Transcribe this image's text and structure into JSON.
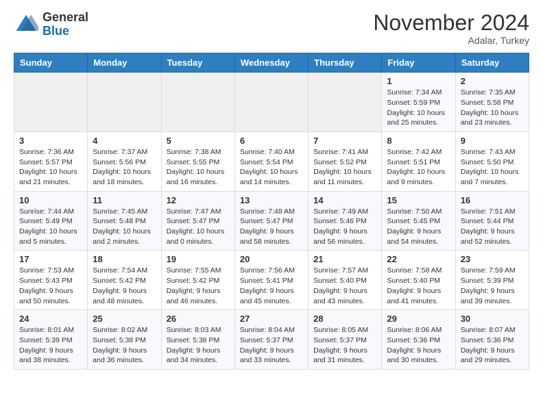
{
  "logo": {
    "general": "General",
    "blue": "Blue"
  },
  "header": {
    "month": "November 2024",
    "location": "Adalar, Turkey"
  },
  "weekdays": [
    "Sunday",
    "Monday",
    "Tuesday",
    "Wednesday",
    "Thursday",
    "Friday",
    "Saturday"
  ],
  "weeks": [
    [
      {
        "day": "",
        "info": ""
      },
      {
        "day": "",
        "info": ""
      },
      {
        "day": "",
        "info": ""
      },
      {
        "day": "",
        "info": ""
      },
      {
        "day": "",
        "info": ""
      },
      {
        "day": "1",
        "info": "Sunrise: 7:34 AM\nSunset: 5:59 PM\nDaylight: 10 hours and 25 minutes."
      },
      {
        "day": "2",
        "info": "Sunrise: 7:35 AM\nSunset: 5:58 PM\nDaylight: 10 hours and 23 minutes."
      }
    ],
    [
      {
        "day": "3",
        "info": "Sunrise: 7:36 AM\nSunset: 5:57 PM\nDaylight: 10 hours and 21 minutes."
      },
      {
        "day": "4",
        "info": "Sunrise: 7:37 AM\nSunset: 5:56 PM\nDaylight: 10 hours and 18 minutes."
      },
      {
        "day": "5",
        "info": "Sunrise: 7:38 AM\nSunset: 5:55 PM\nDaylight: 10 hours and 16 minutes."
      },
      {
        "day": "6",
        "info": "Sunrise: 7:40 AM\nSunset: 5:54 PM\nDaylight: 10 hours and 14 minutes."
      },
      {
        "day": "7",
        "info": "Sunrise: 7:41 AM\nSunset: 5:52 PM\nDaylight: 10 hours and 11 minutes."
      },
      {
        "day": "8",
        "info": "Sunrise: 7:42 AM\nSunset: 5:51 PM\nDaylight: 10 hours and 9 minutes."
      },
      {
        "day": "9",
        "info": "Sunrise: 7:43 AM\nSunset: 5:50 PM\nDaylight: 10 hours and 7 minutes."
      }
    ],
    [
      {
        "day": "10",
        "info": "Sunrise: 7:44 AM\nSunset: 5:49 PM\nDaylight: 10 hours and 5 minutes."
      },
      {
        "day": "11",
        "info": "Sunrise: 7:45 AM\nSunset: 5:48 PM\nDaylight: 10 hours and 2 minutes."
      },
      {
        "day": "12",
        "info": "Sunrise: 7:47 AM\nSunset: 5:47 PM\nDaylight: 10 hours and 0 minutes."
      },
      {
        "day": "13",
        "info": "Sunrise: 7:48 AM\nSunset: 5:47 PM\nDaylight: 9 hours and 58 minutes."
      },
      {
        "day": "14",
        "info": "Sunrise: 7:49 AM\nSunset: 5:46 PM\nDaylight: 9 hours and 56 minutes."
      },
      {
        "day": "15",
        "info": "Sunrise: 7:50 AM\nSunset: 5:45 PM\nDaylight: 9 hours and 54 minutes."
      },
      {
        "day": "16",
        "info": "Sunrise: 7:51 AM\nSunset: 5:44 PM\nDaylight: 9 hours and 52 minutes."
      }
    ],
    [
      {
        "day": "17",
        "info": "Sunrise: 7:53 AM\nSunset: 5:43 PM\nDaylight: 9 hours and 50 minutes."
      },
      {
        "day": "18",
        "info": "Sunrise: 7:54 AM\nSunset: 5:42 PM\nDaylight: 9 hours and 48 minutes."
      },
      {
        "day": "19",
        "info": "Sunrise: 7:55 AM\nSunset: 5:42 PM\nDaylight: 9 hours and 46 minutes."
      },
      {
        "day": "20",
        "info": "Sunrise: 7:56 AM\nSunset: 5:41 PM\nDaylight: 9 hours and 45 minutes."
      },
      {
        "day": "21",
        "info": "Sunrise: 7:57 AM\nSunset: 5:40 PM\nDaylight: 9 hours and 43 minutes."
      },
      {
        "day": "22",
        "info": "Sunrise: 7:58 AM\nSunset: 5:40 PM\nDaylight: 9 hours and 41 minutes."
      },
      {
        "day": "23",
        "info": "Sunrise: 7:59 AM\nSunset: 5:39 PM\nDaylight: 9 hours and 39 minutes."
      }
    ],
    [
      {
        "day": "24",
        "info": "Sunrise: 8:01 AM\nSunset: 5:39 PM\nDaylight: 9 hours and 38 minutes."
      },
      {
        "day": "25",
        "info": "Sunrise: 8:02 AM\nSunset: 5:38 PM\nDaylight: 9 hours and 36 minutes."
      },
      {
        "day": "26",
        "info": "Sunrise: 8:03 AM\nSunset: 5:38 PM\nDaylight: 9 hours and 34 minutes."
      },
      {
        "day": "27",
        "info": "Sunrise: 8:04 AM\nSunset: 5:37 PM\nDaylight: 9 hours and 33 minutes."
      },
      {
        "day": "28",
        "info": "Sunrise: 8:05 AM\nSunset: 5:37 PM\nDaylight: 9 hours and 31 minutes."
      },
      {
        "day": "29",
        "info": "Sunrise: 8:06 AM\nSunset: 5:36 PM\nDaylight: 9 hours and 30 minutes."
      },
      {
        "day": "30",
        "info": "Sunrise: 8:07 AM\nSunset: 5:36 PM\nDaylight: 9 hours and 29 minutes."
      }
    ]
  ]
}
